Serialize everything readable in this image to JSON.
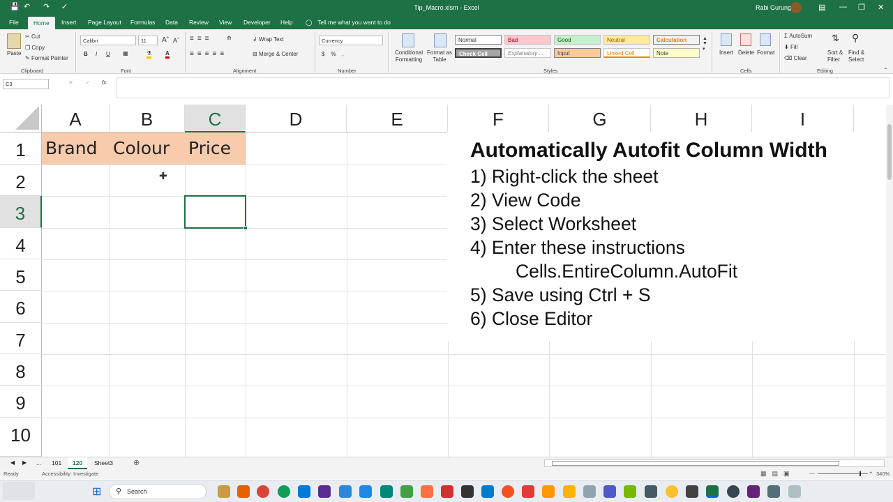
{
  "window": {
    "title": "Tip_Macro.xlsm  -  Excel",
    "user": "Rabi Gurung"
  },
  "tabs": [
    "File",
    "Home",
    "Insert",
    "Page Layout",
    "Formulas",
    "Data",
    "Review",
    "View",
    "Developer",
    "Help"
  ],
  "tell_me": "Tell me what you want to do",
  "ribbon": {
    "clipboard": {
      "paste": "Paste",
      "cut": "Cut",
      "copy": "Copy",
      "format_painter": "Format Painter",
      "group": "Clipboard"
    },
    "font": {
      "name": "Calibri",
      "size": "11",
      "group": "Font"
    },
    "alignment": {
      "wrap": "Wrap Text",
      "merge": "Merge & Center",
      "group": "Alignment"
    },
    "number": {
      "format": "Currency",
      "group": "Number"
    },
    "styles": {
      "conditional": "Conditional Formatting",
      "format_table": "Format as Table",
      "group": "Styles",
      "cells": [
        "Normal",
        "Bad",
        "Good",
        "Neutral",
        "Calculation",
        "Check Cell",
        "Explanatory ...",
        "Input",
        "Linked Cell",
        "Note"
      ]
    },
    "cells": {
      "insert": "Insert",
      "delete": "Delete",
      "format": "Format",
      "group": "Cells"
    },
    "editing": {
      "autosum": "AutoSum",
      "fill": "Fill",
      "clear": "Clear",
      "sort": "Sort & Filter",
      "find": "Find & Select",
      "group": "Editing"
    }
  },
  "namebox": "C3",
  "columns": [
    "A",
    "B",
    "C",
    "D",
    "E",
    "F",
    "G",
    "H",
    "I"
  ],
  "rows": [
    "1",
    "2",
    "3",
    "4",
    "5",
    "6",
    "7",
    "8",
    "9",
    "10"
  ],
  "cells": {
    "A1": "Brand",
    "B1": "Colour",
    "C1": "Price"
  },
  "header_fill": "#f8cbad",
  "accent": "#1e7145",
  "note": {
    "heading": "Automatically Autofit Column Width",
    "lines": [
      "1) Right-click the sheet",
      "2) View Code",
      "3) Select Worksheet",
      "4) Enter these instructions",
      "Cells.EntireColumn.AutoFit",
      "5) Save using Ctrl + S",
      "6) Close Editor"
    ]
  },
  "sheets": [
    "...",
    "101",
    "120",
    "Sheet3"
  ],
  "active_sheet": "120",
  "status": {
    "ready": "Ready",
    "accessibility": "Accessibility: Investigate",
    "zoom": "340%"
  },
  "taskbar": {
    "search": "Search"
  }
}
